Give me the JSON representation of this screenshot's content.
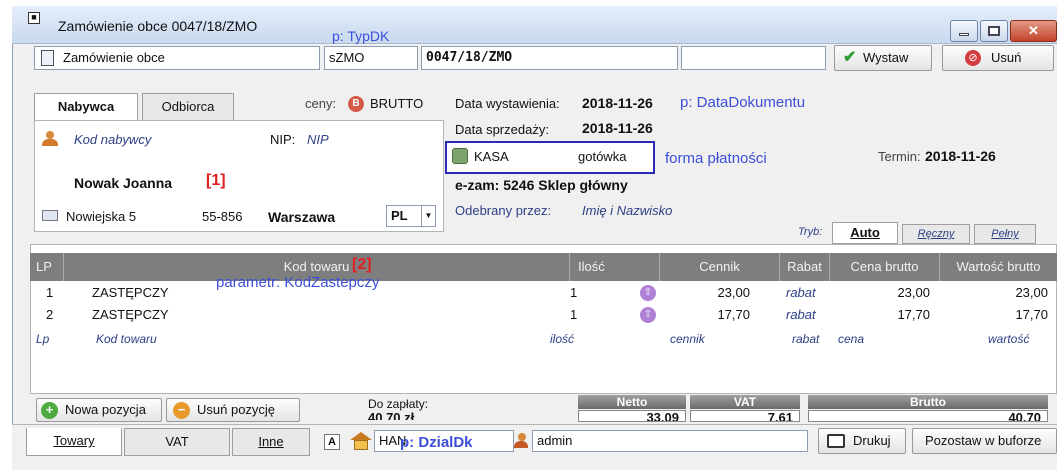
{
  "window": {
    "title": "Zamówienie obce 0047/18/ZMO"
  },
  "header": {
    "doc_type": "Zamówienie obce",
    "series": "sZMO",
    "number": "0047/18/ZMO",
    "issue_button": "Wystaw",
    "delete_button": "Usuń"
  },
  "party_tabs": {
    "buyer": "Nabywca",
    "receiver": "Odbiorca"
  },
  "prices": {
    "label": "ceny:",
    "value": "BRUTTO"
  },
  "buyer": {
    "code_placeholder": "Kod nabywcy",
    "nip_label": "NIP:",
    "nip_value": "NIP",
    "name": "Nowak Joanna",
    "street": "Nowiejska 5",
    "postcode": "55-856",
    "city": "Warszawa",
    "country": "PL"
  },
  "dates": {
    "issue_label": "Data wystawienia:",
    "issue_value": "2018-11-26",
    "sale_label": "Data sprzedaży:",
    "sale_value": "2018-11-26",
    "due_label": "Termin:",
    "due_value": "2018-11-26"
  },
  "payment": {
    "method": "KASA",
    "type": "gotówka"
  },
  "store": "e-zam: 5246 Sklep główny",
  "received": {
    "label": "Odebrany przez:",
    "value": "Imię i Nazwisko"
  },
  "mode": {
    "label": "Tryb:",
    "tabs": [
      "Auto",
      "Ręczny",
      "Pełny"
    ]
  },
  "annotations": {
    "typdk": "p: TypDK",
    "datadok": "p: DataDokumentu",
    "forma": "forma płatności",
    "one": "[1]",
    "two": "[2]",
    "zast": "parametr: KodZastepczy",
    "dzialdk": "p: DzialDk"
  },
  "grid": {
    "columns": [
      "LP",
      "Kod towaru",
      "Ilość",
      "Cennik",
      "Rabat",
      "Cena brutto",
      "Wartość brutto"
    ],
    "rows": [
      {
        "lp": "1",
        "code": "ZASTĘPCZY",
        "qty": "1",
        "price": "23,00",
        "discount": "rabat",
        "unit": "23,00",
        "value": "23,00"
      },
      {
        "lp": "2",
        "code": "ZASTĘPCZY",
        "qty": "1",
        "price": "17,70",
        "discount": "rabat",
        "unit": "17,70",
        "value": "17,70"
      }
    ],
    "entry": {
      "lp": "Lp",
      "code": "Kod towaru",
      "qty": "ilość",
      "price": "cennik",
      "discount": "rabat",
      "unit": "cena",
      "value": "wartość"
    }
  },
  "actions": {
    "add": "Nowa pozycja",
    "remove": "Usuń pozycję"
  },
  "totals": {
    "due_label": "Do zapłaty:",
    "due_value": "40,70 zł",
    "net_label": "Netto",
    "net_value": "33,09",
    "vat_label": "VAT",
    "vat_value": "7,61",
    "gross_label": "Brutto",
    "gross_value": "40,70"
  },
  "footer": {
    "tabs": [
      "Towary",
      "VAT",
      "Inne"
    ],
    "dept": "HAN",
    "user": "admin",
    "print": "Drukuj",
    "buffer": "Pozostaw w buforze"
  },
  "colors": {
    "annotation_blue": "#3b4fd8",
    "annotation_red": "#e02020",
    "grid_header": "#7e7e7e"
  }
}
